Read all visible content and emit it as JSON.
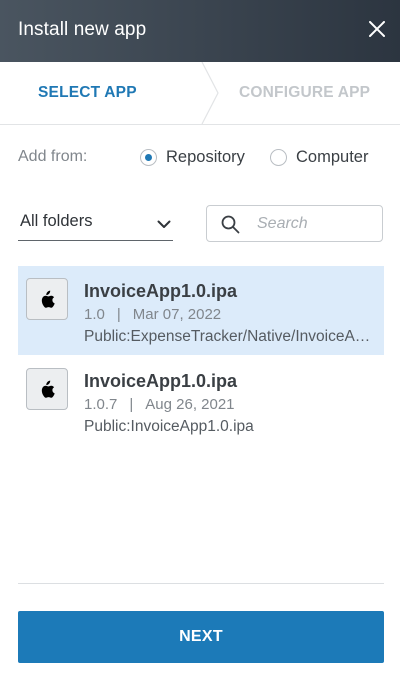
{
  "dialog": {
    "title": "Install new app",
    "close_icon": "close-icon"
  },
  "steps": [
    {
      "label": "SELECT APP",
      "state": "active"
    },
    {
      "label": "CONFIGURE APP",
      "state": "inactive"
    }
  ],
  "source": {
    "label": "Add from:",
    "options": [
      {
        "label": "Repository",
        "selected": true
      },
      {
        "label": "Computer",
        "selected": false
      }
    ]
  },
  "filters": {
    "folder_value": "All folders",
    "search_placeholder": "Search"
  },
  "apps": [
    {
      "name": "InvoiceApp1.0.ipa",
      "version": "1.0",
      "date": "Mar 07, 2022",
      "path": "Public:ExpenseTracker/Native/InvoiceApp1.0.ipa",
      "icon": "apple-icon",
      "selected": true
    },
    {
      "name": "InvoiceApp1.0.ipa",
      "version": "1.0.7",
      "date": "Aug 26, 2021",
      "path": "Public:InvoiceApp1.0.ipa",
      "icon": "apple-icon",
      "selected": false
    }
  ],
  "footer": {
    "next_label": "NEXT"
  },
  "colors": {
    "accent": "#1c7ab8",
    "header_bg": "#343e49",
    "selected_row": "#dcebfa"
  }
}
